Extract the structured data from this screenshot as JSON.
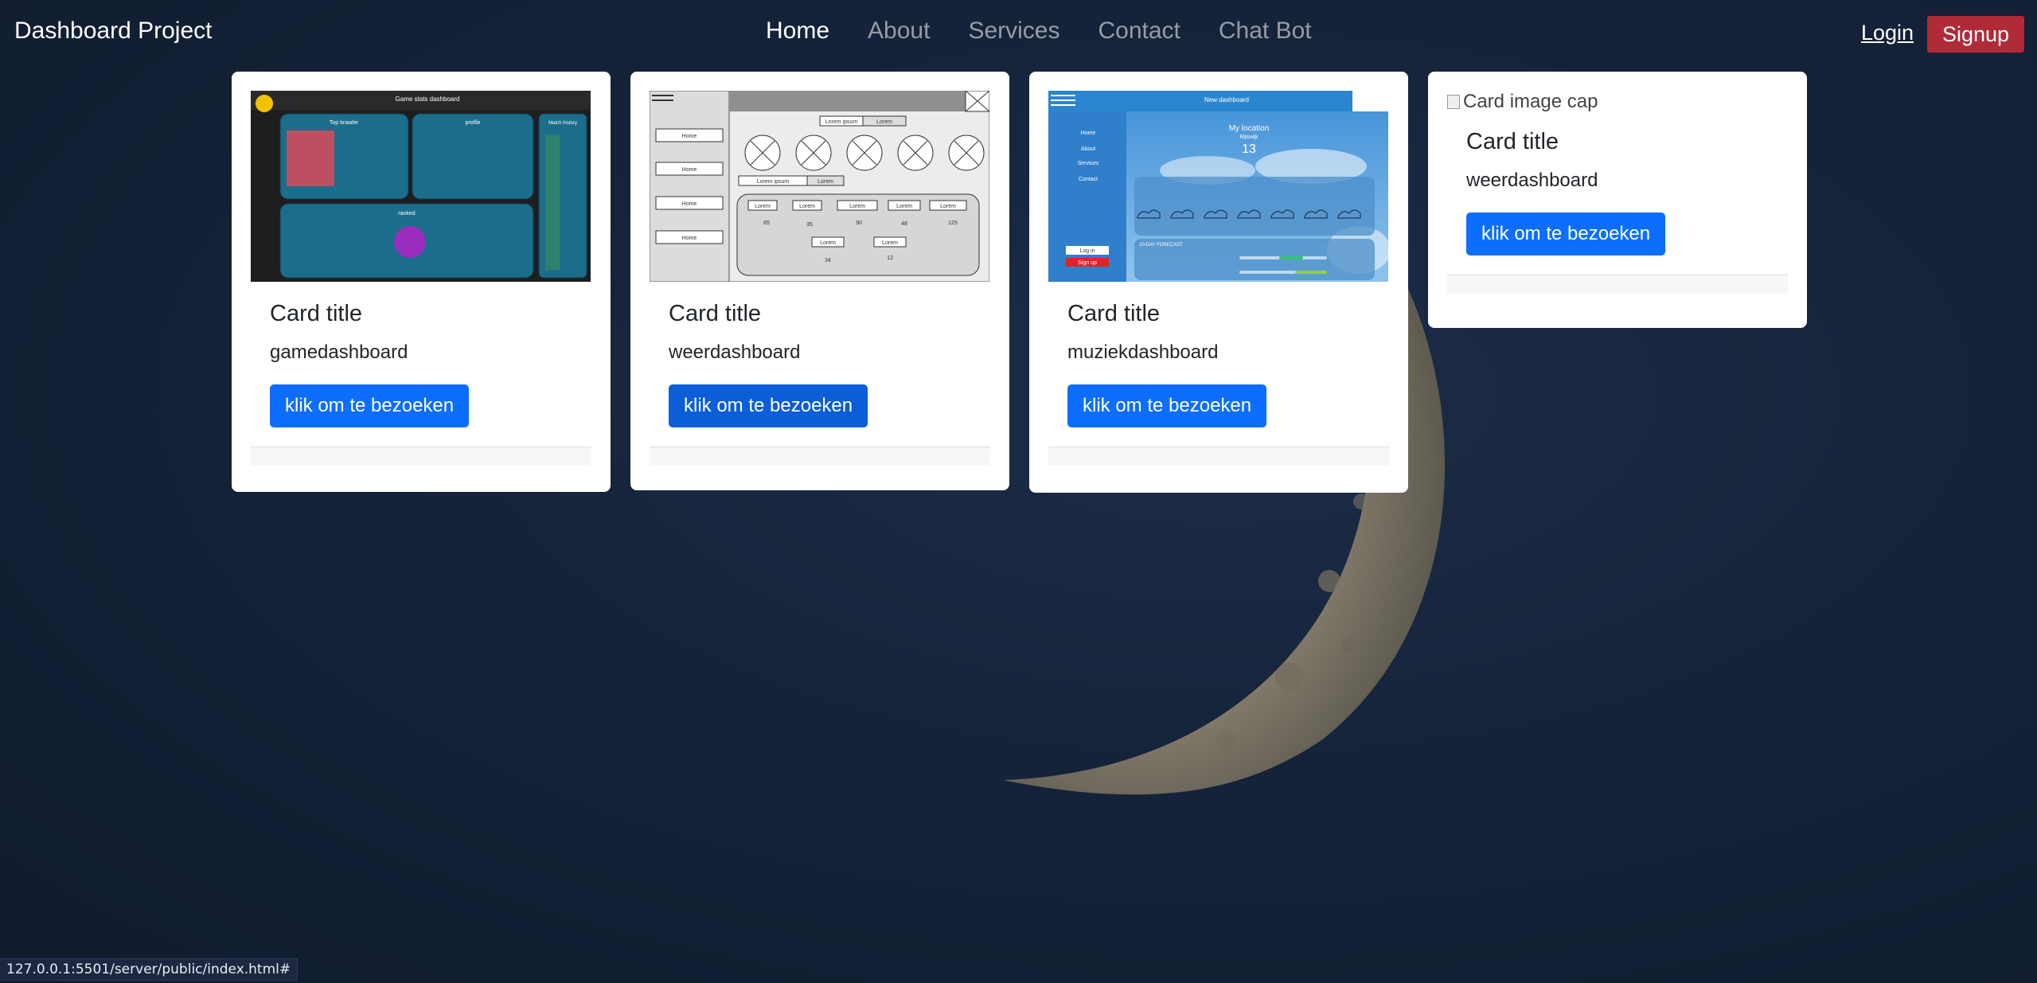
{
  "navbar": {
    "brand": "Dashboard Project",
    "links": [
      "Home",
      "About",
      "Services",
      "Contact",
      "Chat Bot"
    ],
    "login": "Login",
    "signup": "Signup"
  },
  "cards": [
    {
      "title": "Card title",
      "text": "gamedashboard",
      "button": "klik om te bezoeken",
      "preview": {
        "header": "Game stats dashboard",
        "panels": [
          "Top brawler",
          "profile",
          "Match history",
          "ranked"
        ]
      }
    },
    {
      "title": "Card title",
      "text": "weerdashboard",
      "button": "klik om te bezoeken",
      "preview": {
        "sidebar": [
          "Home",
          "Home",
          "Home",
          "Home"
        ],
        "buttons": [
          "Lorem ipsum",
          "Lorem",
          "Lorem ipsum",
          "Lorem"
        ],
        "row": [
          "Lorem",
          "Lorem",
          "Lorem",
          "Lorem",
          "Lorem"
        ],
        "row_values": [
          "65",
          "35",
          "90",
          "48",
          "125"
        ],
        "row2": [
          "Lorem",
          "Lorem"
        ],
        "row2_values": [
          "34",
          "12"
        ]
      }
    },
    {
      "title": "Card title",
      "text": "muziekdashboard",
      "button": "klik om te bezoeken",
      "preview": {
        "header": "New dashboard",
        "menu": [
          "Home",
          "About",
          "Services",
          "Contact"
        ],
        "login": "Log in",
        "signup": "Sign up",
        "location": "My location",
        "city": "Rijswijk",
        "temp": "13",
        "forecast_label": "10-DAY FORECAST"
      }
    },
    {
      "alt": "Card image cap",
      "title": "Card title",
      "text": "weerdashboard",
      "button": "klik om te bezoeken"
    }
  ],
  "status_bar": "127.0.0.1:5501/server/public/index.html#"
}
